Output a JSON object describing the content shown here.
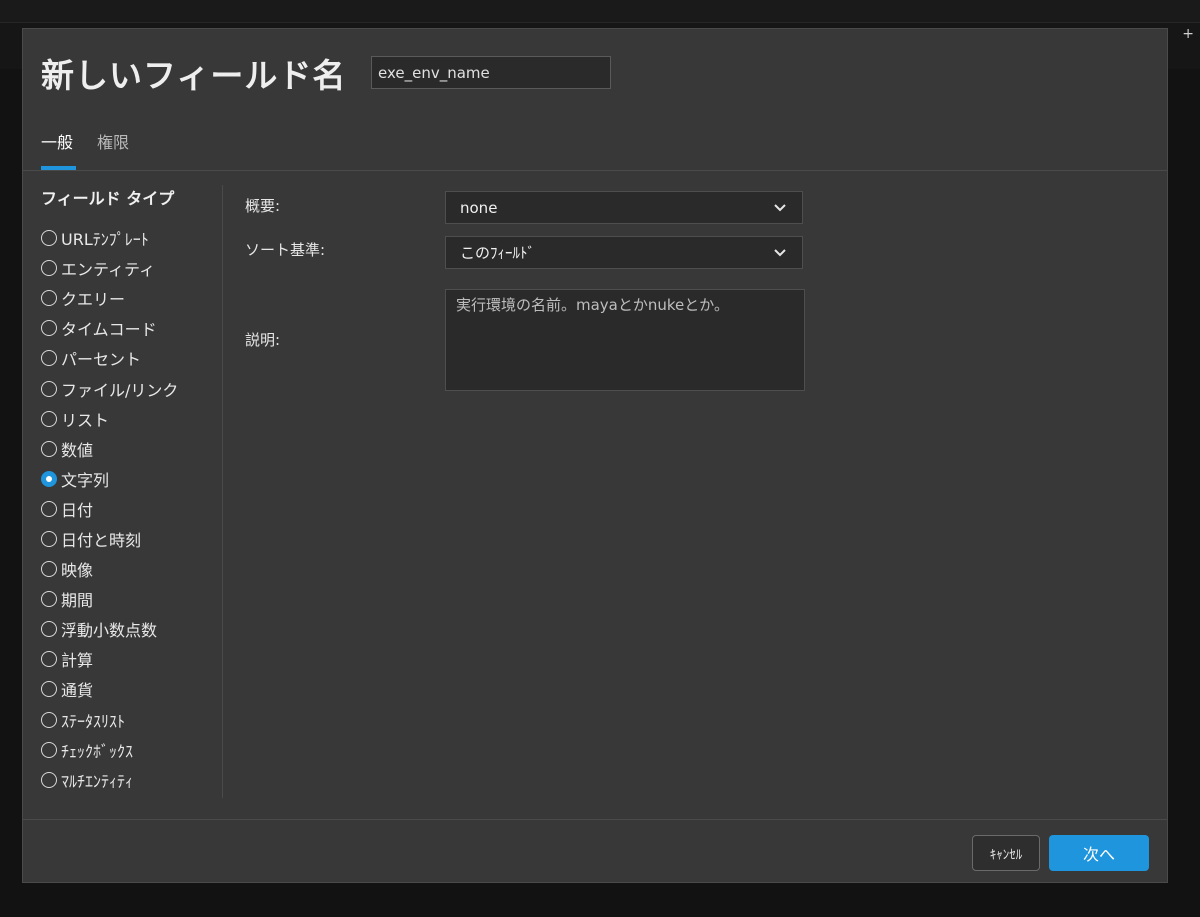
{
  "dialog": {
    "title": "新しいフィールド名",
    "name_value": "exe_env_name",
    "tabs": [
      {
        "label": "一般",
        "active": true
      },
      {
        "label": "権限",
        "active": false
      }
    ]
  },
  "field_types": {
    "heading": "フィールド タイプ",
    "selected": "文字列",
    "items": [
      "URLﾃﾝﾌﾟﾚｰﾄ",
      "エンティティ",
      "クエリー",
      "タイムコード",
      "パーセント",
      "ファイル/リンク",
      "リスト",
      "数値",
      "文字列",
      "日付",
      "日付と時刻",
      "映像",
      "期間",
      "浮動小数点数",
      "計算",
      "通貨",
      "ｽﾃｰﾀｽﾘｽﾄ",
      "ﾁｪｯｸﾎﾞｯｸｽ",
      "ﾏﾙﾁｴﾝﾃｨﾃｨ"
    ]
  },
  "form": {
    "summary_label": "概要:",
    "summary_value": "none",
    "sort_label": "ソート基準:",
    "sort_value": "このﾌｨｰﾙﾄﾞ",
    "description_label": "説明:",
    "description_value": "実行環境の名前。mayaとかnukeとか。"
  },
  "buttons": {
    "cancel": "ｷｬﾝｾﾙ",
    "next": "次へ"
  },
  "colors": {
    "accent": "#1e95dc",
    "dialog_bg": "#383838",
    "input_bg": "#2a2a2a"
  },
  "icons": {
    "select_chevron": "chevron-down-icon",
    "add": "plus-icon"
  }
}
